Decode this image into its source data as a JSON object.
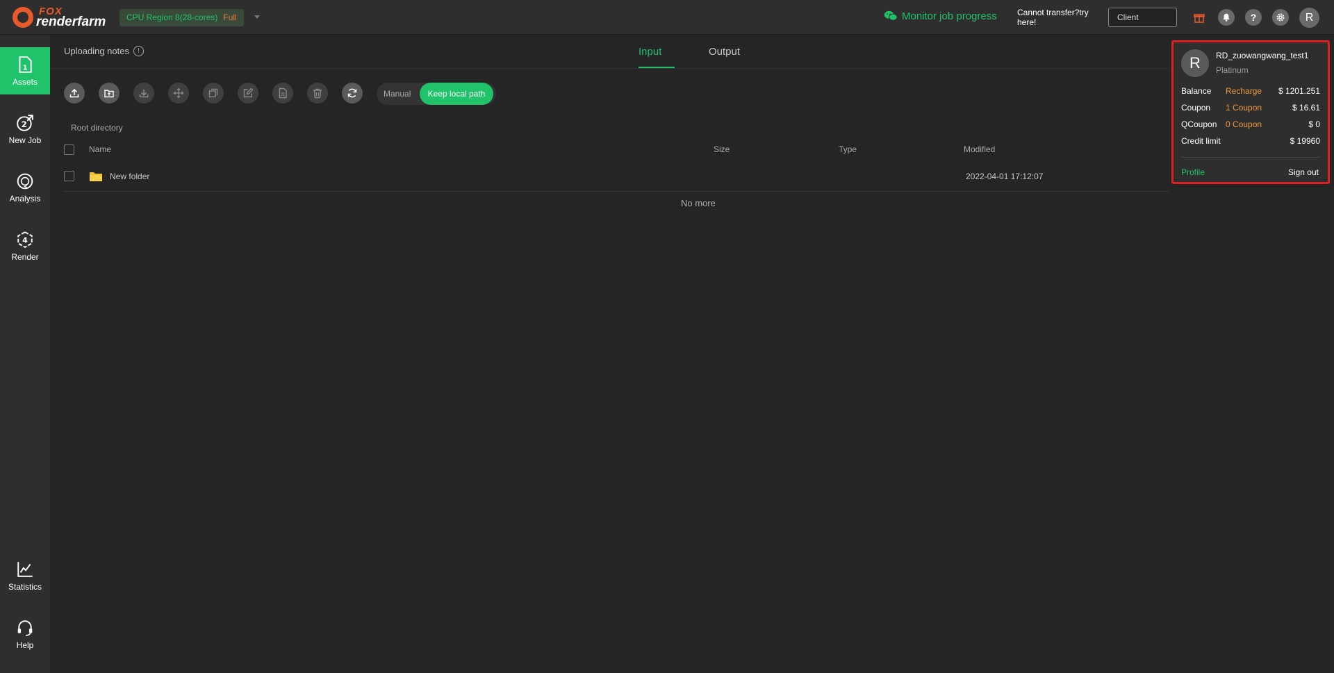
{
  "app": {
    "logo_top": "FOX",
    "logo_bottom": "renderfarm"
  },
  "topbar": {
    "region_label": "CPU Region 8(28-cores)",
    "region_status": "Full",
    "monitor_label": "Monitor job progress",
    "cannot_transfer": "Cannot transfer?try here!",
    "client_placeholder": "Client",
    "avatar_letter": "R"
  },
  "sidebar": {
    "items": [
      {
        "label": "Assets",
        "icon": "assets-icon"
      },
      {
        "label": "New Job",
        "icon": "new-job-icon"
      },
      {
        "label": "Analysis",
        "icon": "analysis-icon"
      },
      {
        "label": "Render",
        "icon": "render-icon"
      },
      {
        "label": "Statistics",
        "icon": "statistics-icon"
      },
      {
        "label": "Help",
        "icon": "help-icon"
      }
    ]
  },
  "main": {
    "uploading_notes": "Uploading notes",
    "tabs": [
      {
        "label": "Input"
      },
      {
        "label": "Output"
      }
    ],
    "toggle": {
      "manual": "Manual",
      "keep": "Keep local path"
    },
    "breadcrumb": "Root directory",
    "columns": {
      "name": "Name",
      "size": "Size",
      "type": "Type",
      "modified": "Modified"
    },
    "rows": [
      {
        "name": "New folder",
        "size": "",
        "type": "",
        "modified": "2022-04-01 17:12:07"
      }
    ],
    "no_more": "No more"
  },
  "profile": {
    "avatar_letter": "R",
    "username": "RD_zuowangwang_test1",
    "tier": "Platinum",
    "balance": {
      "label": "Balance",
      "action": "Recharge",
      "value": "$ 1201.251"
    },
    "coupon": {
      "label": "Coupon",
      "action": "1 Coupon",
      "value": "$ 16.61"
    },
    "qcoupon": {
      "label": "QCoupon",
      "action": "0 Coupon",
      "value": "$ 0"
    },
    "credit": {
      "label": "Credit limit",
      "value": "$ 19960"
    },
    "profile_link": "Profile",
    "sign_out": "Sign out"
  },
  "colors": {
    "accent": "#20c26a",
    "brand": "#e95a2b",
    "highlight_border": "#e02020",
    "coupon": "#f09a3a"
  }
}
